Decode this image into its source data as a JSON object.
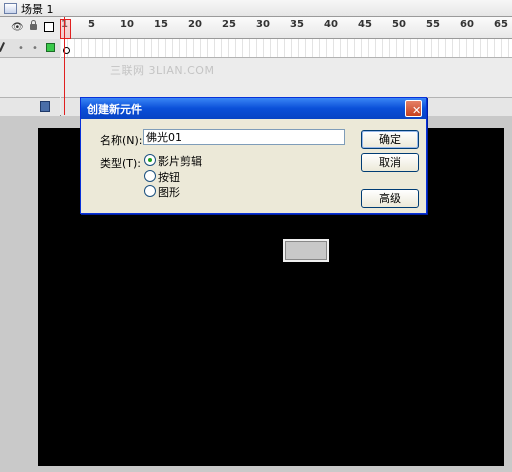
{
  "scene": {
    "label": "场景 1"
  },
  "timeline": {
    "frame_numbers": [
      "1",
      "5",
      "10",
      "15",
      "20",
      "25",
      "30",
      "35",
      "40",
      "45",
      "50",
      "55",
      "60",
      "65"
    ]
  },
  "watermark": "三联网 3LIAN.COM",
  "dialog": {
    "title": "创建新元件",
    "close_glyph": "✕",
    "name_label": "名称(N):",
    "name_value": "佛光01",
    "type_label": "类型(T):",
    "types": [
      {
        "label": "影片剪辑",
        "checked": true
      },
      {
        "label": "按钮",
        "checked": false
      },
      {
        "label": "图形",
        "checked": false
      }
    ],
    "ok_label": "确定",
    "cancel_label": "取消",
    "advanced_label": "高级"
  },
  "colors": {
    "layer_color": "#3ac94a",
    "playhead": "#e02020",
    "stage": "#000000",
    "title_bar": "#0a4fd8"
  }
}
